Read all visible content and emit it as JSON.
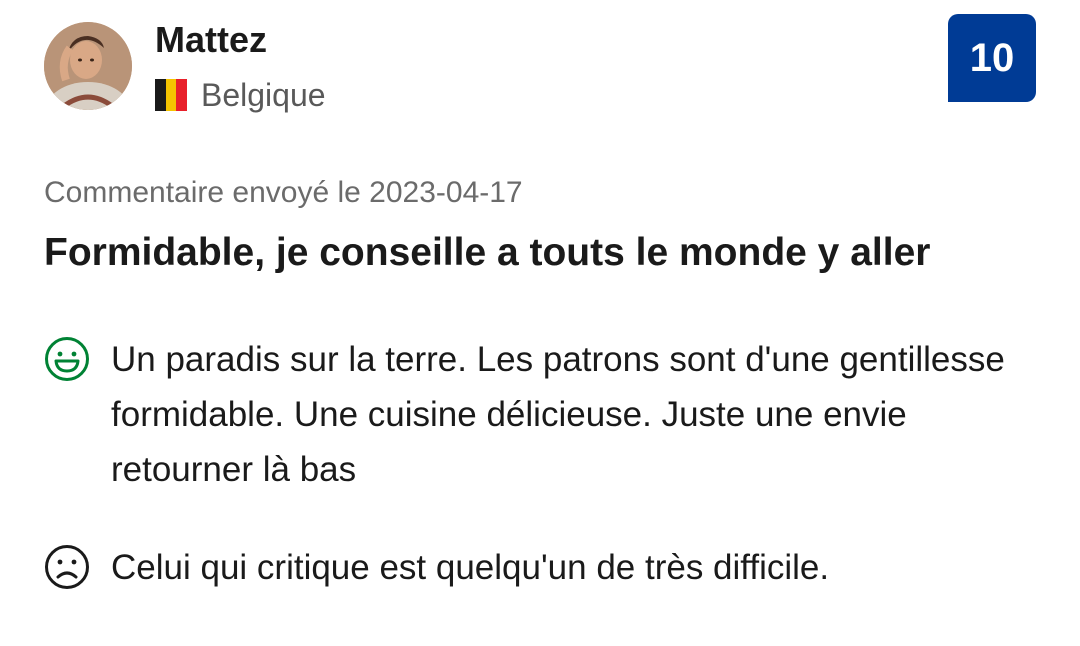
{
  "reviewer": {
    "name": "Mattez",
    "avatar_icon": "reviewer-avatar-photo",
    "country": "Belgique",
    "flag_icon": "belgium-flag-icon",
    "flag_colors": [
      "#1a1a1a",
      "#f5c400",
      "#e8202a"
    ]
  },
  "score": {
    "value": "10",
    "color": "#003b95"
  },
  "review": {
    "date_text": "Commentaire envoyé le 2023-04-17",
    "title": "Formidable, je conseille a touts le monde y aller",
    "positive": {
      "icon": "happy-face-icon",
      "icon_color": "#008234",
      "text": "Un paradis sur la terre. Les patrons sont d'une gentillesse formidable. Une cuisine délicieuse. Juste une envie retourner là bas"
    },
    "negative": {
      "icon": "sad-face-icon",
      "icon_color": "#1a1a1a",
      "text": "Celui qui critique est quelqu'un de très difficile."
    }
  }
}
